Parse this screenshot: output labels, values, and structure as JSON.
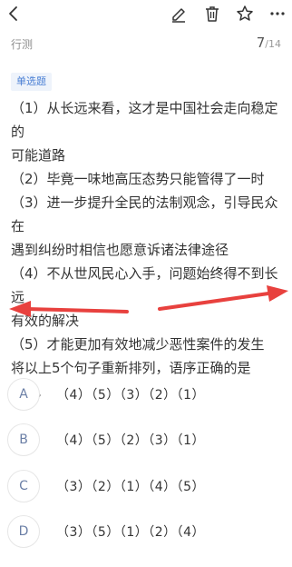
{
  "toolbar": {
    "back_icon": "chevron-left-icon",
    "edit_icon": "pencil-icon",
    "delete_icon": "trash-icon",
    "favorite_icon": "star-icon",
    "more_icon": "more-icon"
  },
  "subheader": {
    "category": "行测",
    "current": "7",
    "total": "/14"
  },
  "question": {
    "type": "单选题",
    "lines": [
      "（1）从长远来看，这才是中国社会走向稳定的",
      "可能道路",
      "（2）毕竟一味地高压态势只能管得了一时",
      "（3）进一步提升全民的法制观念，引导民众在",
      "遇到纠纷时相信也愿意诉诸法律途径",
      "（4）不从世风民心入手，问题始终得不到长远",
      "有效的解决",
      "（5）才能更加有效地减少恶性案件的发生",
      "将以上5个句子重新排列，语序正确的是",
      "（  ）。"
    ]
  },
  "options": [
    {
      "letter": "A",
      "text": "（4）（5）（3）（2）（1）"
    },
    {
      "letter": "B",
      "text": "（4）（5）（2）（3）（1）"
    },
    {
      "letter": "C",
      "text": "（3）（2）（1）（4）（5）"
    },
    {
      "letter": "D",
      "text": "（3）（5）（1）（2）（4）"
    }
  ],
  "colors": {
    "accent": "#4a7fd4",
    "arrow": "#e8413e"
  }
}
